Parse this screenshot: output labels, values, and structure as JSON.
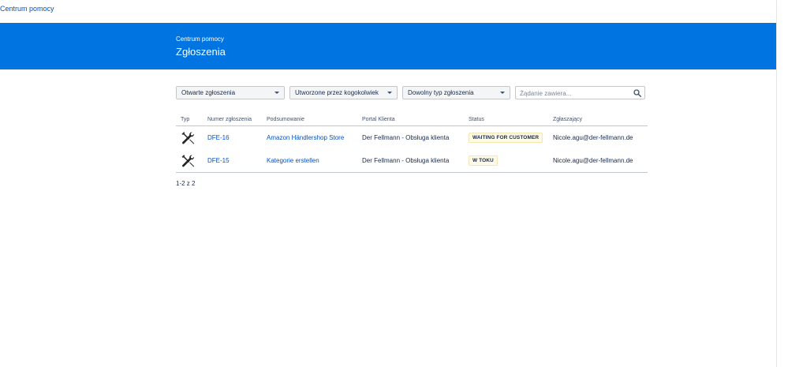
{
  "topnav": {
    "home_link": "Centrum pomocy"
  },
  "banner": {
    "breadcrumb": "Centrum pomocy",
    "title": "Zgłoszenia"
  },
  "filters": {
    "status": "Otwarte zgłoszenia",
    "creator": "Utworzone przez kogokolwiek",
    "type": "Dowolny typ zgłoszenia",
    "search_placeholder": "Żądanie zawiera..."
  },
  "table": {
    "headers": {
      "type": "Typ",
      "number": "Numer zgłoszenia",
      "summary": "Podsumowanie",
      "portal": "Portal Klienta",
      "status": "Status",
      "reporter": "Zgłaszający"
    },
    "rows": [
      {
        "type_icon": "wrench-screwdriver-icon",
        "number": "DFE-16",
        "summary": "Amazon Händlershop Store",
        "portal": "Der Fellmann - Obsługa klienta",
        "status": "WAITING FOR CUSTOMER",
        "reporter": "Nicole.agu@der-fellmann.de"
      },
      {
        "type_icon": "wrench-screwdriver-icon",
        "number": "DFE-15",
        "summary": "Kategorie erstellen",
        "portal": "Der Fellmann - Obsługa klienta",
        "status": "W TOKU",
        "reporter": "Nicole.agu@der-fellmann.de"
      }
    ]
  },
  "pagination": {
    "label": "1-2 z 2"
  },
  "colors": {
    "banner": "#0074e0",
    "link": "#0052cc",
    "status_bg": "#fffae6"
  }
}
